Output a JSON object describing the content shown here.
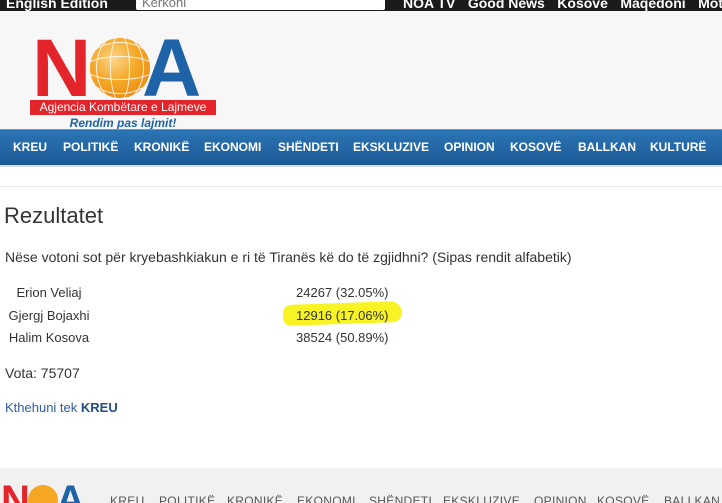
{
  "topbar": {
    "edition": "English Edition",
    "search_placeholder": "Kërkoni",
    "links": [
      "NOA TV",
      "Good News",
      "Kosovë",
      "Maqedoni",
      "Mot"
    ]
  },
  "logo": {
    "letter_n": "N",
    "letter_a": "A",
    "tagline": "Agjencia Kombëtare e Lajmeve",
    "slogan": "Rendim pas lajmit!"
  },
  "nav": [
    "KREU",
    "POLITIKË",
    "KRONIKË",
    "EKONOMI",
    "SHËNDETI",
    "EKSKLUZIVE",
    "OPINION",
    "KOSOVË",
    "BALLKAN",
    "KULTURË"
  ],
  "content": {
    "title": "Rezultatet",
    "question": "Nëse votoni sot për kryebashkiakun e ri të Tiranës kë do të zgjidhni? (Sipas rendit alfabetik)",
    "results": [
      {
        "name": "Erion Veliaj",
        "value": "24267 (32.05%)"
      },
      {
        "name": "Gjergj Bojaxhi",
        "value": "12916 (17.06%)"
      },
      {
        "name": "Halim Kosova",
        "value": "38524 (50.89%)"
      }
    ],
    "votes": "Vota: 75707",
    "back_prefix": "Kthehuni tek",
    "back_link": "KREU"
  },
  "footer": {
    "letter_n": "N",
    "letter_a": "A",
    "links": [
      "KREU",
      "POLITIKË",
      "KRONIKË",
      "EKONOMI",
      "SHËNDETI",
      "EKSKLUZIVE",
      "OPINION",
      "KOSOVË",
      "BALLKAN"
    ]
  }
}
